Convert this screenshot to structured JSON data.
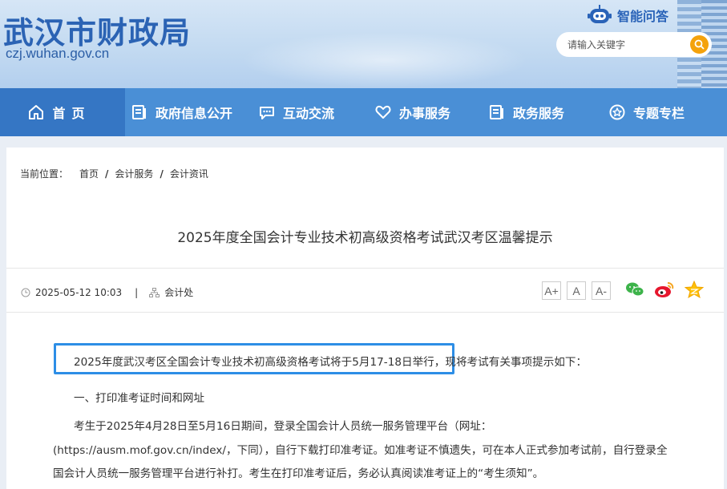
{
  "header": {
    "site_title": "武汉市财政局",
    "site_url": "czj.wuhan.gov.cn",
    "ai_label": "智能问答",
    "search_placeholder": "请输入关键字"
  },
  "nav": [
    {
      "label": "首页",
      "icon": "home-icon"
    },
    {
      "label": "政府信息公开",
      "icon": "document-list-icon"
    },
    {
      "label": "互动交流",
      "icon": "chat-icon"
    },
    {
      "label": "办事服务",
      "icon": "heart-icon"
    },
    {
      "label": "政务服务",
      "icon": "list-icon"
    },
    {
      "label": "专题专栏",
      "icon": "star-circle-icon"
    }
  ],
  "breadcrumb": {
    "prefix": "当前位置：",
    "items": [
      "首页",
      "会计服务",
      "会计资讯"
    ],
    "separator": "/"
  },
  "article": {
    "title": "2025年度全国会计专业技术初高级资格考试武汉考区温馨提示",
    "date": "2025-05-12 10:03",
    "pipe": "|",
    "source": "会计处",
    "font_sizes": [
      "A+",
      "A",
      "A-"
    ],
    "share_icons": [
      "wechat-icon",
      "weibo-icon",
      "qzone-star-icon"
    ],
    "paragraphs": [
      "2025年度武汉考区全国会计专业技术初高级资格考试将于5月17-18日举行，现将考试有关事项提示如下：",
      "一、打印准考证时间和网址",
      "考生于2025年4月28日至5月16日期间，登录全国会计人员统一服务管理平台（网址：　(https://ausm.mof.gov.cn/index/，下同），自行下载打印准考证。如准考证不慎遗失，可在本人正式参加考试前，自行登录全国会计人员统一服务管理平台进行补打。考生在打印准考证后，务必认真阅读准考证上的“考生须知”。"
    ]
  },
  "colors": {
    "nav_bg": "#4a8fd6",
    "nav_active": "#3576c4",
    "title_blue": "#2b63b4",
    "highlight_border": "#2d8ee6",
    "search_button": "#f4a20c"
  }
}
